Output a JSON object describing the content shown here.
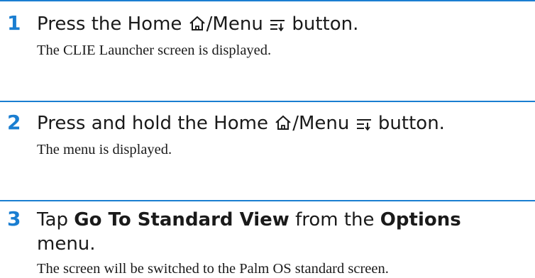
{
  "accent_color": "#1a7ed1",
  "steps": [
    {
      "number": "1",
      "h_a": "Press the Home ",
      "h_b": "/Menu ",
      "h_c": " button.",
      "body": "The CLIE Launcher screen is displayed.",
      "icons": [
        "home-icon",
        "menu-icon"
      ]
    },
    {
      "number": "2",
      "h_a": "Press and hold the Home ",
      "h_b": "/Menu ",
      "h_c": " button.",
      "body": "The menu is displayed.",
      "icons": [
        "home-icon",
        "menu-icon"
      ]
    },
    {
      "number": "3",
      "h_a": "Tap ",
      "h_bold1": "Go To Standard View",
      "h_b": " from the ",
      "h_bold2": "Options",
      "h_line2": "menu.",
      "body": "The screen will be switched to the Palm OS standard screen."
    }
  ]
}
